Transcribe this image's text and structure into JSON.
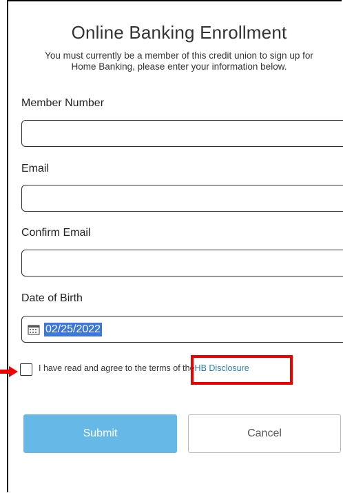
{
  "form": {
    "title": "Online Banking Enrollment",
    "subtitle_line1": "You must currently be a member of this credit union to sign up for",
    "subtitle_line2": "Home Banking, please enter your information below.",
    "member_number": {
      "label": "Member Number",
      "value": ""
    },
    "email": {
      "label": "Email",
      "value": ""
    },
    "confirm_email": {
      "label": "Confirm Email",
      "value": ""
    },
    "date_of_birth": {
      "label": "Date of Birth",
      "value": "02/25/2022"
    },
    "terms": {
      "text": "I have read and agree to the terms of the",
      "link": "HB Disclosure",
      "checked": false
    },
    "submit_label": "Submit",
    "cancel_label": "Cancel"
  },
  "annotations": {
    "highlight_color": "#ee0000",
    "arrow_color": "#ee0000"
  },
  "colors": {
    "submit_bg": "#66b9e6",
    "link": "#2a7fb5",
    "date_selection": "#3b78d8"
  }
}
